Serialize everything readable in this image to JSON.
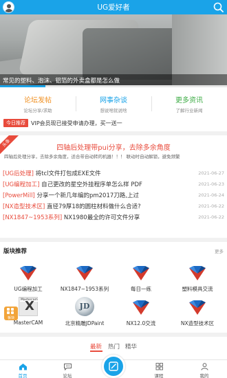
{
  "header": {
    "title": "UG爱好者",
    "avatar_icon": "user-avatar-icon",
    "search_icon": "search-icon",
    "color": "#1aa3e8"
  },
  "banner": {
    "caption": "常见的塑料、泡沫、铝箔的外卖盒都是怎么做",
    "slide_progress": 0.2
  },
  "quick_links": [
    {
      "title": "论坛发帖",
      "subtitle": "论坛分享/求助",
      "color": "#f08f1f"
    },
    {
      "title": "网事杂谈",
      "subtitle": "想说啥就说啥",
      "color": "#1aa3e8"
    },
    {
      "title": "更多资讯",
      "subtitle": "了解行业新闻",
      "color": "#3cab44"
    }
  ],
  "notice": {
    "tag": "今日推荐",
    "text": "VIP会员现已接受申请办理，买一送一"
  },
  "featured": {
    "ribbon": "头条",
    "title": "四轴后处理带pui分享，去除多余角度",
    "description": "四轴后处理分享，去除多余角度，适合带自动转的机器！！！ 联动时自动解锁，避免频繁"
  },
  "posts": [
    {
      "category": "[UG后处理]",
      "title": " 将tcl文件打包成EXE文件",
      "date": "2021-06-27"
    },
    {
      "category": "[UG编程加工]",
      "title": " 自己更改的星空外挂程序单怎么样 PDF",
      "date": "2021-06-23"
    },
    {
      "category": "[PowerMill]",
      "title": " 分享一个新几年编的pm2017刀路,上过",
      "date": "2021-06-24"
    },
    {
      "category": "[NX造型技术区]",
      "title": " 直径79厚18的圆柱材料做什么合适?",
      "date": "2021-06-22"
    },
    {
      "category": "[NX1847~1953系列]",
      "title": " NX1980最全的许可文件分享",
      "date": "2021-06-22"
    }
  ],
  "blocks": {
    "heading": "版块推荐",
    "more": "更多",
    "items": [
      {
        "label": "UG编程加工",
        "icon": "nx-logo-icon"
      },
      {
        "label": "NX1847~1953系列",
        "icon": "nx-logo-icon"
      },
      {
        "label": "每日一练",
        "icon": "nx-logo-icon"
      },
      {
        "label": "塑料模具交流",
        "icon": "nx-logo-icon"
      },
      {
        "label": "MasterCAM",
        "icon": "mastercam-logo-icon"
      },
      {
        "label": "北京精雕JDPaint",
        "icon": "jdpaint-logo-icon"
      },
      {
        "label": "NX12.0交流",
        "icon": "nx-logo-icon"
      },
      {
        "label": "NX造型技术区",
        "icon": "nx-logo-icon"
      }
    ],
    "mastercam_mark": "Mastercam",
    "jd_mark": "JD"
  },
  "float_button": {
    "label": "板块",
    "icon": "grid-icon"
  },
  "feed_tabs": [
    {
      "label": "最新",
      "active": true
    },
    {
      "label": "热门",
      "active": false
    },
    {
      "label": "精华",
      "active": false
    }
  ],
  "bottom_nav": [
    {
      "label": "首页",
      "icon": "home-icon",
      "active": true
    },
    {
      "label": "论坛",
      "icon": "chat-icon",
      "active": false
    },
    {
      "label": "",
      "icon": "post-icon",
      "active": false
    },
    {
      "label": "课程",
      "icon": "course-grid-icon",
      "active": false
    },
    {
      "label": "我的",
      "icon": "profile-icon",
      "active": false
    }
  ]
}
